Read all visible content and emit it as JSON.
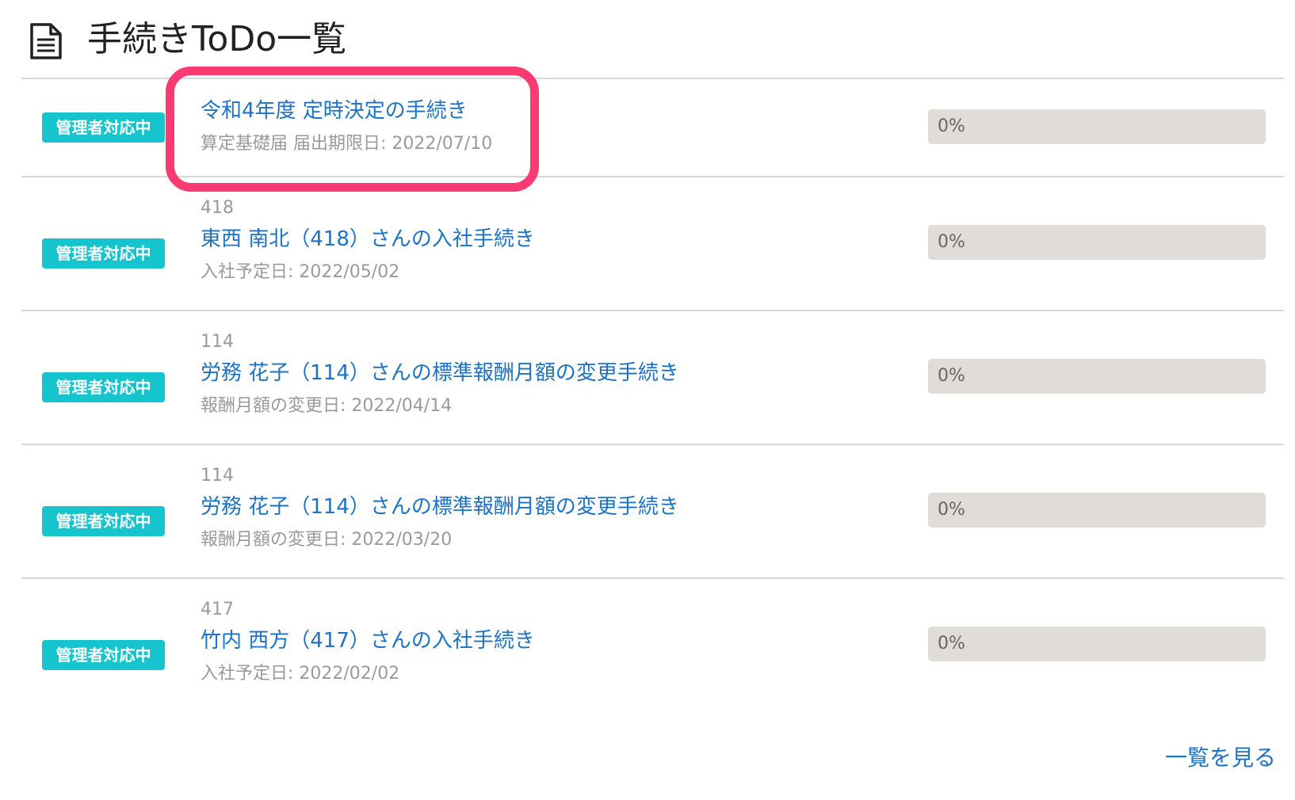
{
  "header": {
    "title": "手続きToDo一覧",
    "icon": "document-icon"
  },
  "colors": {
    "badge": "#16c4ce",
    "link": "#1a73c8",
    "highlight": "#fa3a73",
    "progress_track": "#e0dcd8"
  },
  "todos": [
    {
      "status": "管理者対応中",
      "number": "",
      "title": "令和4年度 定時決定の手続き",
      "detail": "算定基礎届 届出期限日: 2022/07/10",
      "progress_label": "0%",
      "progress": 0
    },
    {
      "status": "管理者対応中",
      "number": "418",
      "title": "東西 南北（418）さんの入社手続き",
      "detail": "入社予定日: 2022/05/02",
      "progress_label": "0%",
      "progress": 0
    },
    {
      "status": "管理者対応中",
      "number": "114",
      "title": "労務 花子（114）さんの標準報酬月額の変更手続き",
      "detail": "報酬月額の変更日: 2022/04/14",
      "progress_label": "0%",
      "progress": 0
    },
    {
      "status": "管理者対応中",
      "number": "114",
      "title": "労務 花子（114）さんの標準報酬月額の変更手続き",
      "detail": "報酬月額の変更日: 2022/03/20",
      "progress_label": "0%",
      "progress": 0
    },
    {
      "status": "管理者対応中",
      "number": "417",
      "title": "竹内 西方（417）さんの入社手続き",
      "detail": "入社予定日: 2022/02/02",
      "progress_label": "0%",
      "progress": 0
    }
  ],
  "footer": {
    "view_all_label": "一覧を見る"
  }
}
